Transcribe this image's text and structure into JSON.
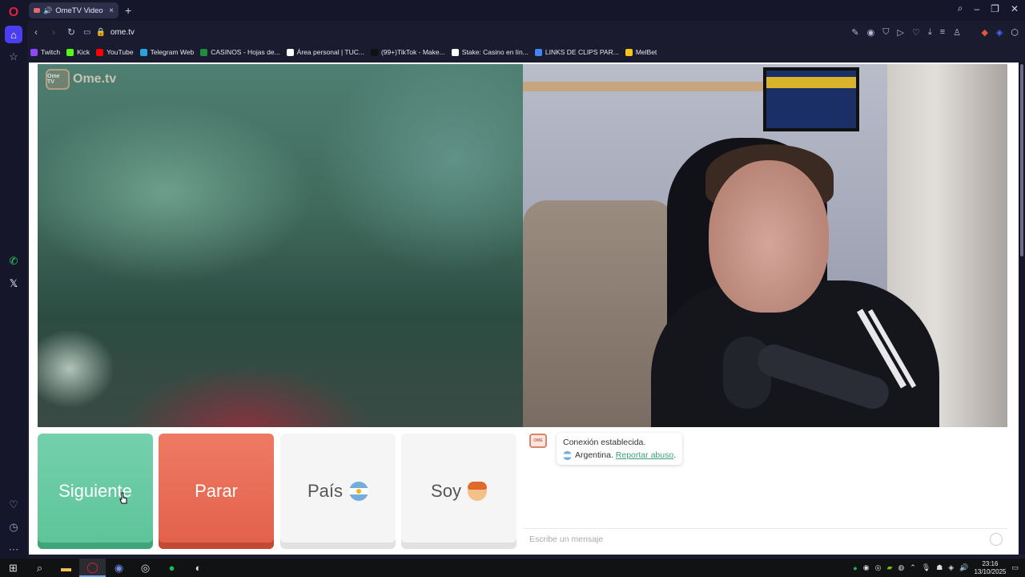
{
  "browser": {
    "tab_title": "OmeTV Video Chat -...",
    "url": "ome.tv",
    "bookmarks": [
      {
        "label": "Twitch",
        "color": "#9146ff"
      },
      {
        "label": "Kick",
        "color": "#53fc18"
      },
      {
        "label": "YouTube",
        "color": "#ff0000"
      },
      {
        "label": "Telegram Web",
        "color": "#2aa3df"
      },
      {
        "label": "CASINOS - Hojas de...",
        "color": "#1e8e3e"
      },
      {
        "label": "Área personal | TUC...",
        "color": "#ffffff"
      },
      {
        "label": "(99+)TikTok - Make...",
        "color": "#111111"
      },
      {
        "label": "Stake: Casino en lín...",
        "color": "#ffffff"
      },
      {
        "label": "LINKS DE CLIPS PAR...",
        "color": "#4285f4"
      },
      {
        "label": "MelBet",
        "color": "#f5c518"
      }
    ]
  },
  "site": {
    "logo_text": "Ome.tv",
    "logo_badge": "Ome TV"
  },
  "controls": {
    "next_label": "Siguiente",
    "stop_label": "Parar",
    "country_label": "País",
    "gender_label": "Soy"
  },
  "chat": {
    "system_line1": "Conexión establecida.",
    "country": "Argentina.",
    "report_link": "Reportar abuso",
    "report_suffix": ".",
    "input_placeholder": "Escribe un mensaje"
  },
  "taskbar": {
    "time": "23:16",
    "date": "13/10/2025"
  },
  "colors": {
    "next_green": "#5cc497",
    "stop_red": "#e2604a",
    "link_green": "#3aa17c"
  }
}
